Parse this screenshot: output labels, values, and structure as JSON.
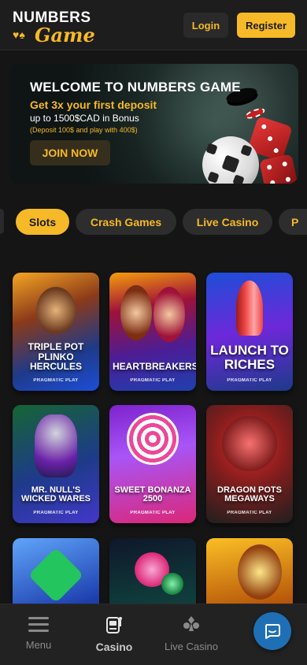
{
  "header": {
    "logo_top": "NUMBERS",
    "logo_bottom": "Game",
    "login_label": "Login",
    "register_label": "Register"
  },
  "banner": {
    "title": "WELCOME TO NUMBERS GAME",
    "subtitle": "Get 3x your first deposit",
    "bonus_line": "up to 1500$CAD in Bonus",
    "note": "(Deposit 100$ and play with 400$)",
    "cta_label": "JOIN NOW"
  },
  "categories": [
    {
      "label": "Slots",
      "active": true
    },
    {
      "label": "Crash Games",
      "active": false
    },
    {
      "label": "Live Casino",
      "active": false
    },
    {
      "label": "P",
      "active": false
    }
  ],
  "games": [
    {
      "title": "TRIPLE POT PLINKO HERCULES",
      "provider": "PRAGMATIC PLAY",
      "colors": [
        "#1e3a8a",
        "#f59e0b"
      ]
    },
    {
      "title": "HEARTBREAKERS",
      "provider": "PRAGMATIC PLAY",
      "colors": [
        "#7c1d3e",
        "#2563eb"
      ]
    },
    {
      "title": "LAUNCH TO RICHES",
      "provider": "PRAGMATIC PLAY",
      "colors": [
        "#1d4ed8",
        "#7c3aed"
      ]
    },
    {
      "title": "MR. NULL'S WICKED WARES",
      "provider": "PRAGMATIC PLAY",
      "colors": [
        "#14532d",
        "#1e3a8a"
      ]
    },
    {
      "title": "SWEET BONANZA 2500",
      "provider": "PRAGMATIC PLAY",
      "colors": [
        "#6b21a8",
        "#ec4899"
      ]
    },
    {
      "title": "DRAGON POTS MEGAWAYS",
      "provider": "PRAGMATIC PLAY",
      "colors": [
        "#7f1d1d",
        "#1f1f1f"
      ]
    },
    {
      "title": "",
      "provider": "",
      "colors": [
        "#1e40af",
        "#22c55e"
      ]
    },
    {
      "title": "",
      "provider": "",
      "colors": [
        "#0f3a3a",
        "#2dd4bf"
      ]
    },
    {
      "title": "",
      "provider": "",
      "colors": [
        "#92400e",
        "#fbbf24"
      ]
    }
  ],
  "bottom_nav": {
    "menu_label": "Menu",
    "casino_label": "Casino",
    "live_label": "Live Casino"
  },
  "icons": {
    "menu": "hamburger-icon",
    "casino": "slot-machine-icon",
    "live": "cards-suits-icon",
    "chat": "chat-icon"
  }
}
